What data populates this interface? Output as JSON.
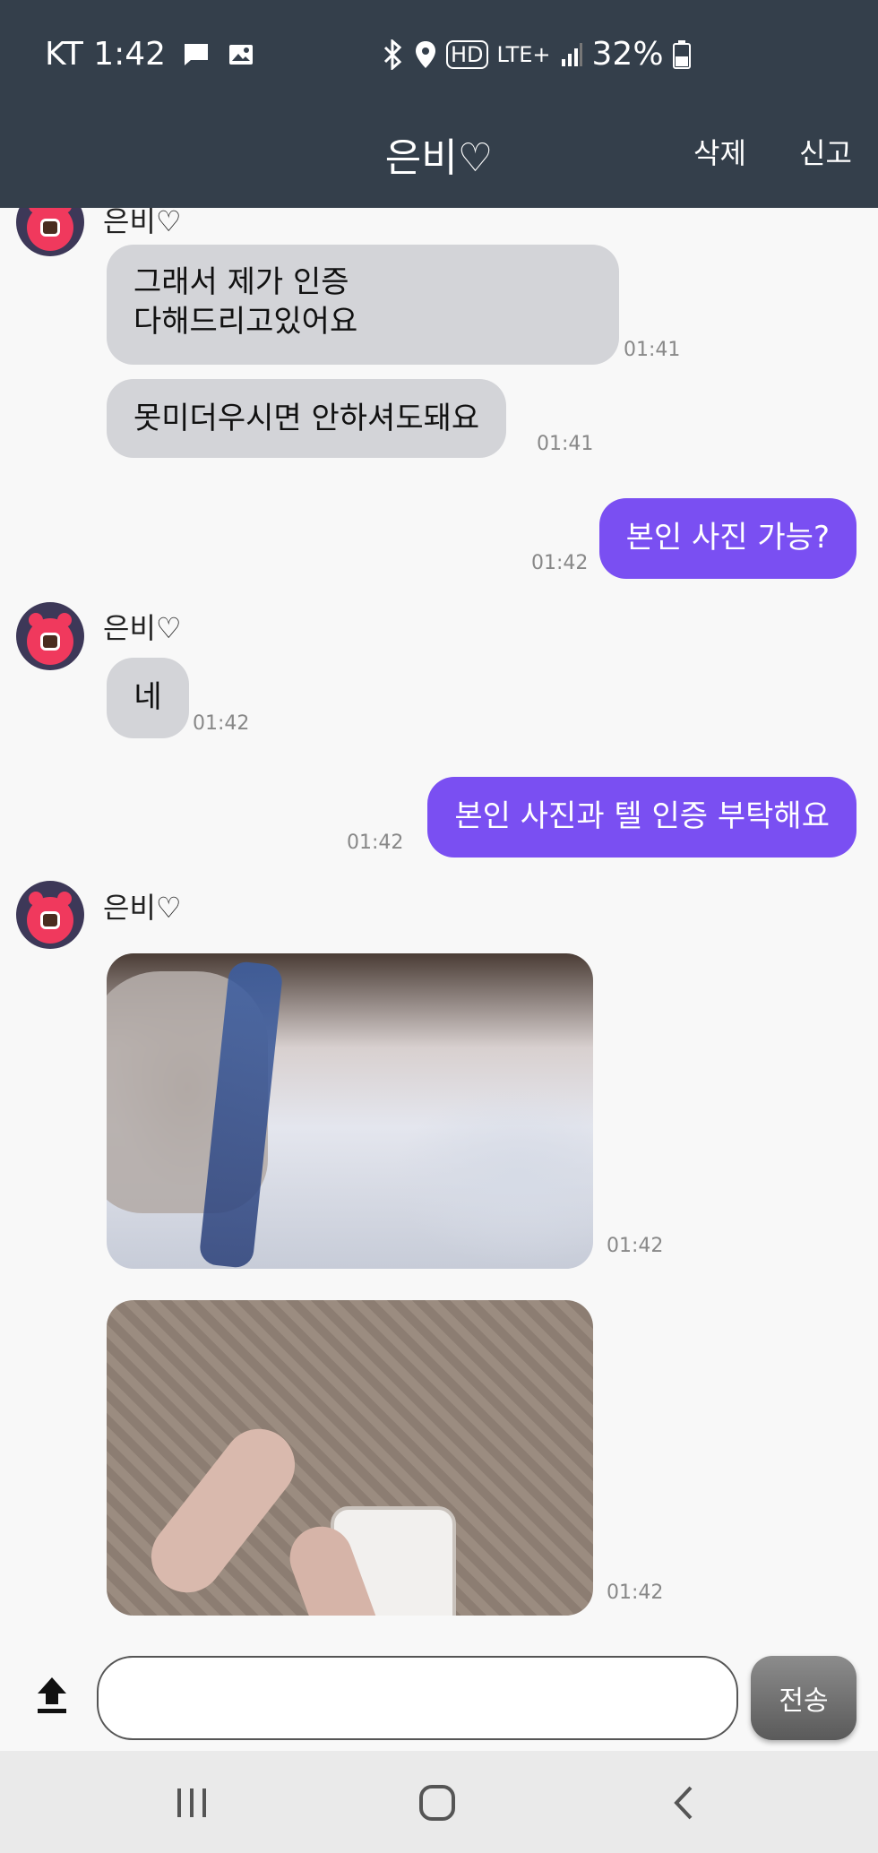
{
  "status_bar": {
    "carrier_time": "KT 1:42",
    "battery": "32%",
    "network": "LTE+",
    "hd": "HD"
  },
  "header": {
    "title": "은비♡",
    "delete_label": "삭제",
    "report_label": "신고"
  },
  "messages": [
    {
      "dir": "in",
      "sender": "은비♡",
      "text_lines": [
        "그래서 제가 인증",
        "다해드리고있어요"
      ],
      "time": "01:41"
    },
    {
      "dir": "in",
      "text": "못미더우시면 안하셔도돼요",
      "time": "01:41"
    },
    {
      "dir": "out",
      "text": "본인 사진 가능?",
      "time": "01:42"
    },
    {
      "dir": "in",
      "sender": "은비♡",
      "text": "네",
      "time": "01:42"
    },
    {
      "dir": "out",
      "text": "본인 사진과 텔 인증 부탁해요",
      "time": "01:42"
    },
    {
      "dir": "in",
      "sender": "은비♡",
      "type": "image",
      "time": "01:42"
    },
    {
      "dir": "in",
      "type": "image",
      "time": "01:42"
    }
  ],
  "input": {
    "placeholder": "",
    "send_label": "전송",
    "upload_icon": "upload-icon"
  },
  "nav": {
    "recent_icon": "recent-apps-icon",
    "home_icon": "home-icon",
    "back_icon": "back-icon"
  },
  "colors": {
    "header_bg": "#343f4b",
    "out_bubble": "#7a4ff2",
    "in_bubble": "#d3d4d8"
  }
}
